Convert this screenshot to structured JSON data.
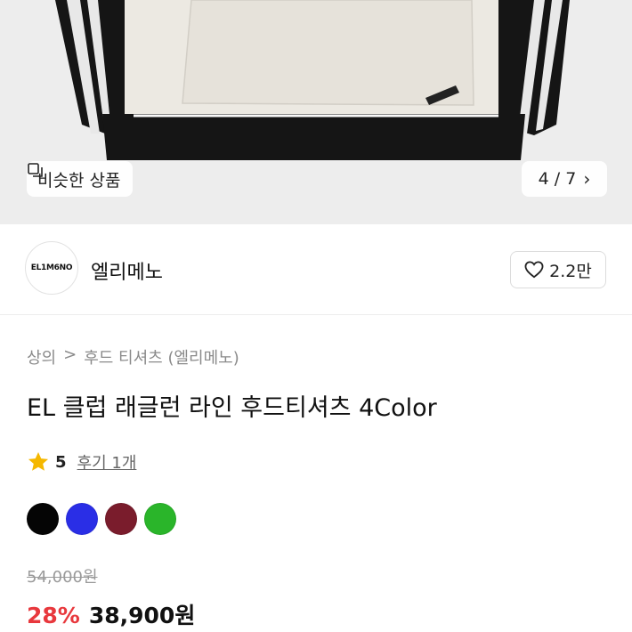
{
  "hero": {
    "similar_label": "비슷한 상품",
    "page_indicator": "4 / 7",
    "chevron": "›"
  },
  "brand": {
    "logo_text": "EL1M6NO",
    "name": "엘리메노",
    "likes": "2.2만"
  },
  "breadcrumb": {
    "level1": "상의",
    "separator": ">",
    "level2": "후드 티셔츠 (엘리메노)"
  },
  "product": {
    "title": "EL 클럽 래글런 라인 후드티셔츠 4Color",
    "rating": "5",
    "reviews": "후기 1개"
  },
  "color_options": [
    {
      "name": "black",
      "hex": "#050505"
    },
    {
      "name": "blue",
      "hex": "#2a2ee6"
    },
    {
      "name": "burgundy",
      "hex": "#7a1c2c"
    },
    {
      "name": "green",
      "hex": "#2ab52a"
    }
  ],
  "price": {
    "original": "54,000원",
    "discount": "28%",
    "sale": "38,900원"
  },
  "icons": {
    "similar": "similar-items-icon",
    "heart": "heart-icon",
    "star": "star-icon"
  },
  "colors": {
    "accent_red": "#e8383d",
    "star_yellow": "#f5b800",
    "hero_bg": "#ededed"
  }
}
